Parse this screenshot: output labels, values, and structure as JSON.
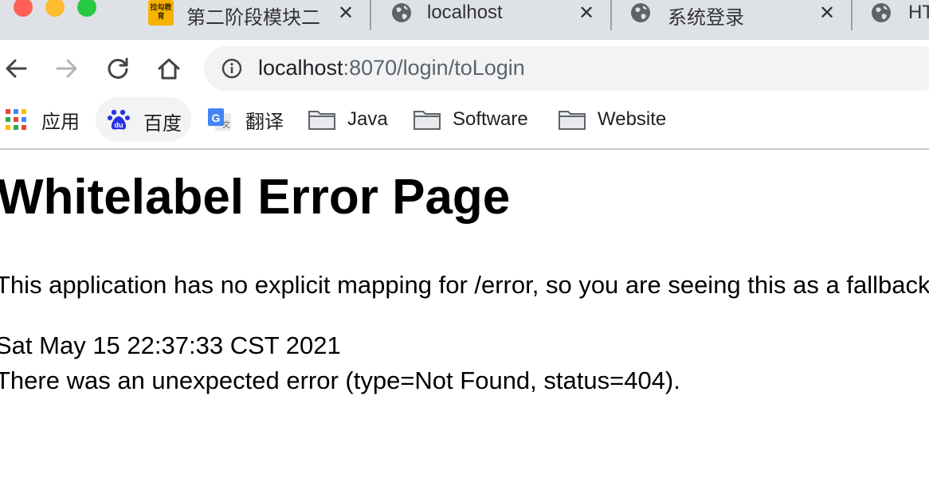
{
  "tabs": [
    {
      "title": "第二阶段模块二",
      "favicon": "lagou-icon",
      "favicon_text": "拉勾教育"
    },
    {
      "title": "localhost",
      "favicon": "globe-icon"
    },
    {
      "title": "系统登录",
      "favicon": "globe-icon"
    },
    {
      "title": "HT",
      "favicon": "globe-icon"
    }
  ],
  "tab_close_glyph": "✕",
  "address_bar": {
    "host": "localhost",
    "path": ":8070/login/toLogin"
  },
  "bookmarks": [
    {
      "label": "应用",
      "icon": "apps-grid-icon"
    },
    {
      "label": "百度",
      "icon": "baidu-icon"
    },
    {
      "label": "翻译",
      "icon": "google-translate-icon"
    },
    {
      "label": "Java",
      "icon": "folder-icon"
    },
    {
      "label": "Software",
      "icon": "folder-icon"
    },
    {
      "label": "Website",
      "icon": "folder-icon"
    }
  ],
  "page": {
    "title": "Whitelabel Error Page",
    "message": "This application has no explicit mapping for /error, so you are seeing this as a fallback.",
    "timestamp": "Sat May 15 22:37:33 CST 2021",
    "error": "There was an unexpected error (type=Not Found, status=404)."
  },
  "colors": {
    "tabstrip": "#dee1e6",
    "omnibox": "#f1f3f4",
    "close": "#ff5f57",
    "minimize": "#febc2e",
    "maximize": "#28c840"
  }
}
